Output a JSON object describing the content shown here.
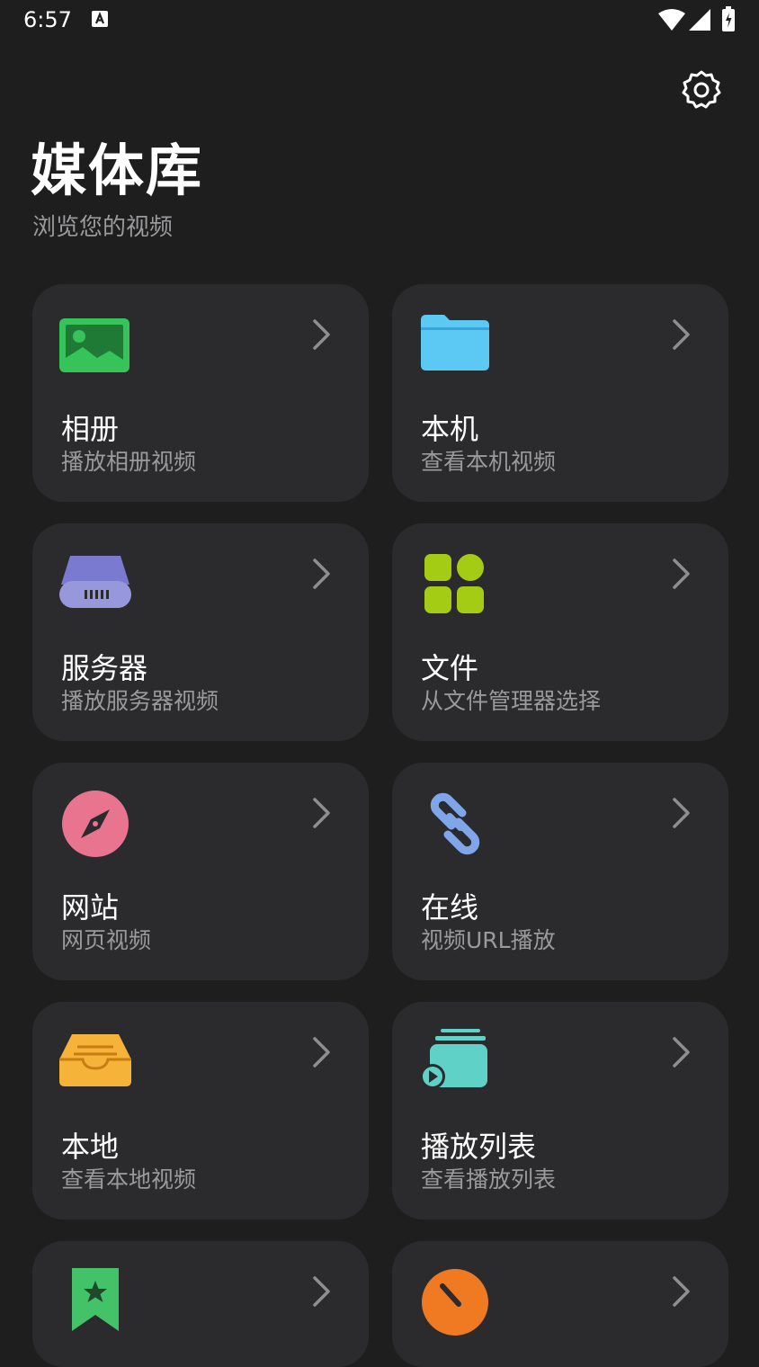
{
  "status_bar": {
    "time": "6:57"
  },
  "header": {
    "title": "媒体库",
    "subtitle": "浏览您的视频"
  },
  "cards": [
    {
      "label": "相册",
      "desc": "播放相册视频",
      "icon": "image-icon",
      "color": "#36c45a"
    },
    {
      "label": "本机",
      "desc": "查看本机视频",
      "icon": "folder-icon",
      "color": "#5cc9f5"
    },
    {
      "label": "服务器",
      "desc": "播放服务器视频",
      "icon": "server-icon",
      "color": "#8f8fd8"
    },
    {
      "label": "文件",
      "desc": "从文件管理器选择",
      "icon": "apps-grid-icon",
      "color": "#a5cc14"
    },
    {
      "label": "网站",
      "desc": "网页视频",
      "icon": "compass-icon",
      "color": "#e8748f"
    },
    {
      "label": "在线",
      "desc": "视频URL播放",
      "icon": "link-icon",
      "color": "#7fa6e8"
    },
    {
      "label": "本地",
      "desc": "查看本地视频",
      "icon": "inbox-tray-icon",
      "color": "#f5b33a"
    },
    {
      "label": "播放列表",
      "desc": "查看播放列表",
      "icon": "playlist-icon",
      "color": "#5fd1c7"
    },
    {
      "label": "",
      "desc": "",
      "icon": "bookmark-star-icon",
      "color": "#43c26a"
    },
    {
      "label": "",
      "desc": "",
      "icon": "timer-icon",
      "color": "#f07a22"
    }
  ]
}
